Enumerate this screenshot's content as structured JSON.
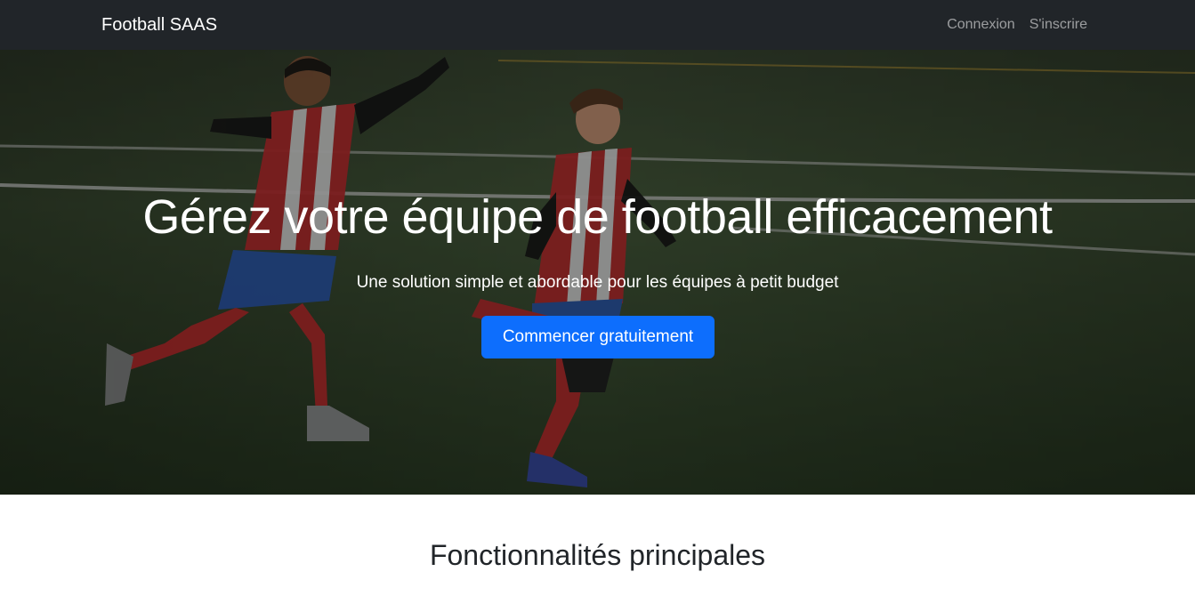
{
  "navbar": {
    "brand": "Football SAAS",
    "links": [
      {
        "label": "Connexion"
      },
      {
        "label": "S'inscrire"
      }
    ],
    "background": "#212529"
  },
  "hero": {
    "title": "Gérez votre équipe de football efficacement",
    "subtitle": "Une solution simple et abordable pour les équipes à petit budget",
    "cta_label": "Commencer gratuitement",
    "cta_color": "#0d6efd",
    "background_image": "two-young-football-players-celebrating-on-pitch"
  },
  "features": {
    "title": "Fonctionnalités principales"
  }
}
